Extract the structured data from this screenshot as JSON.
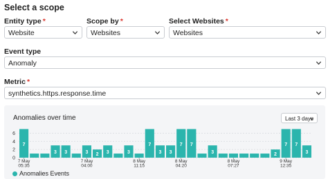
{
  "page": {
    "title": "Select a scope"
  },
  "form": {
    "entity_type": {
      "label": "Entity type",
      "value": "Website"
    },
    "scope_by": {
      "label": "Scope by",
      "value": "Websites"
    },
    "select_websites": {
      "label": "Select Websites",
      "value": "Websites"
    },
    "event_type": {
      "label": "Event type",
      "value": "Anomaly"
    },
    "metric": {
      "label": "Metric",
      "value": "synthetics.https.response.time"
    },
    "required_mark": "*"
  },
  "panel": {
    "title": "Anomalies over time",
    "range_select": "Last 3 days",
    "legend": "Anomalies Events"
  },
  "colors": {
    "bar": "#2bb5ad",
    "required": "#d9332b"
  },
  "chart_data": {
    "type": "bar",
    "ylim": [
      0,
      8
    ],
    "yticks": [
      0,
      2,
      4,
      6
    ],
    "values": [
      7,
      1,
      1,
      3,
      3,
      1,
      3,
      2,
      3,
      1,
      3,
      1,
      7,
      3,
      3,
      7,
      7,
      1,
      3,
      1,
      1,
      1,
      1,
      1,
      2,
      7,
      7,
      3
    ],
    "data_labels": [
      "7",
      "",
      "",
      "3",
      "3",
      "",
      "3",
      "2",
      "3",
      "",
      "3",
      "",
      "7",
      "3",
      "3",
      "7",
      "7",
      "",
      "3",
      "",
      "",
      "",
      "",
      "",
      "2",
      "7",
      "7",
      "3"
    ],
    "xticks": [
      {
        "index": 0,
        "date": "7 May",
        "time": "05:35"
      },
      {
        "index": 6,
        "date": "7 May",
        "time": "04:00"
      },
      {
        "index": 11,
        "date": "8 May",
        "time": "11:15"
      },
      {
        "index": 15,
        "date": "8 May",
        "time": "04:20"
      },
      {
        "index": 20,
        "date": "8 May",
        "time": "07:27"
      },
      {
        "index": 25,
        "date": "9 May",
        "time": "12:35"
      }
    ],
    "legend": [
      "Anomalies Events"
    ]
  }
}
